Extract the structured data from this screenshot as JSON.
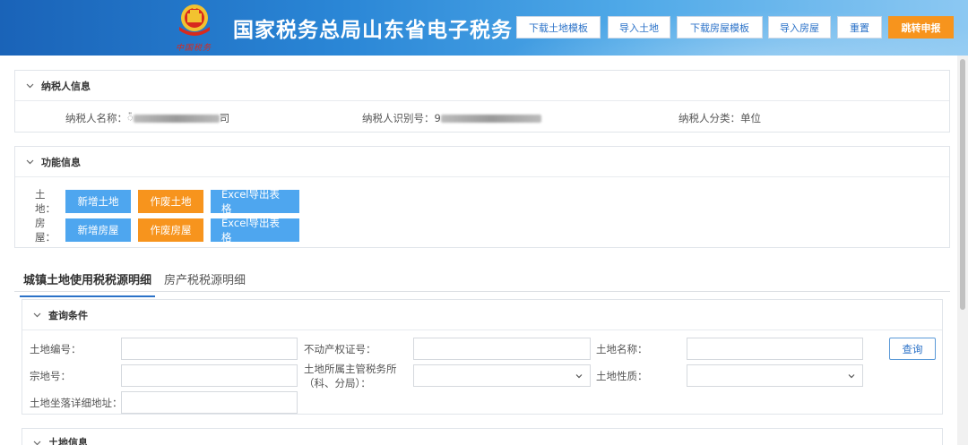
{
  "header": {
    "title": "国家税务总局山东省电子税务",
    "emblem_caption": "中国税务",
    "buttons": {
      "download_land_template": "下载土地模板",
      "import_land": "导入土地",
      "download_house_template": "下载房屋模板",
      "import_house": "导入房屋",
      "reset": "重置",
      "jump_declare": "跳转申报"
    }
  },
  "taxpayer": {
    "section_title": "纳税人信息",
    "name_label": "纳税人名称：",
    "name_prefix": "៉",
    "name_suffix": "司",
    "id_label": "纳税人识别号：",
    "id_prefix": "9",
    "category_label": "纳税人分类：",
    "category_value": "单位"
  },
  "functions": {
    "section_title": "功能信息",
    "land_label": "土地：",
    "house_label": "房屋：",
    "land_buttons": {
      "add": "新增土地",
      "void": "作废土地",
      "export": "Excel导出表格"
    },
    "house_buttons": {
      "add": "新增房屋",
      "void": "作废房屋",
      "export": "Excel导出表格"
    }
  },
  "tabs": {
    "land": "城镇土地使用税税源明细",
    "house": "房产税税源明细"
  },
  "query": {
    "section_title": "查询条件",
    "land_no_label": "土地编号：",
    "property_cert_label": "不动产权证号：",
    "land_name_label": "土地名称：",
    "parcel_no_label": "宗地号：",
    "tax_office_label_1": "土地所属主管税务所",
    "tax_office_label_2": "（科、分局）：",
    "land_nature_label": "土地性质：",
    "address_label": "土地坐落详细地址：",
    "search_button": "查询"
  },
  "land_info": {
    "section_title": "土地信息"
  },
  "colors": {
    "header_blue": "#1a63b8",
    "accent_orange": "#f7941d",
    "button_blue": "#4ea6ef",
    "link_blue": "#2b72c8"
  }
}
